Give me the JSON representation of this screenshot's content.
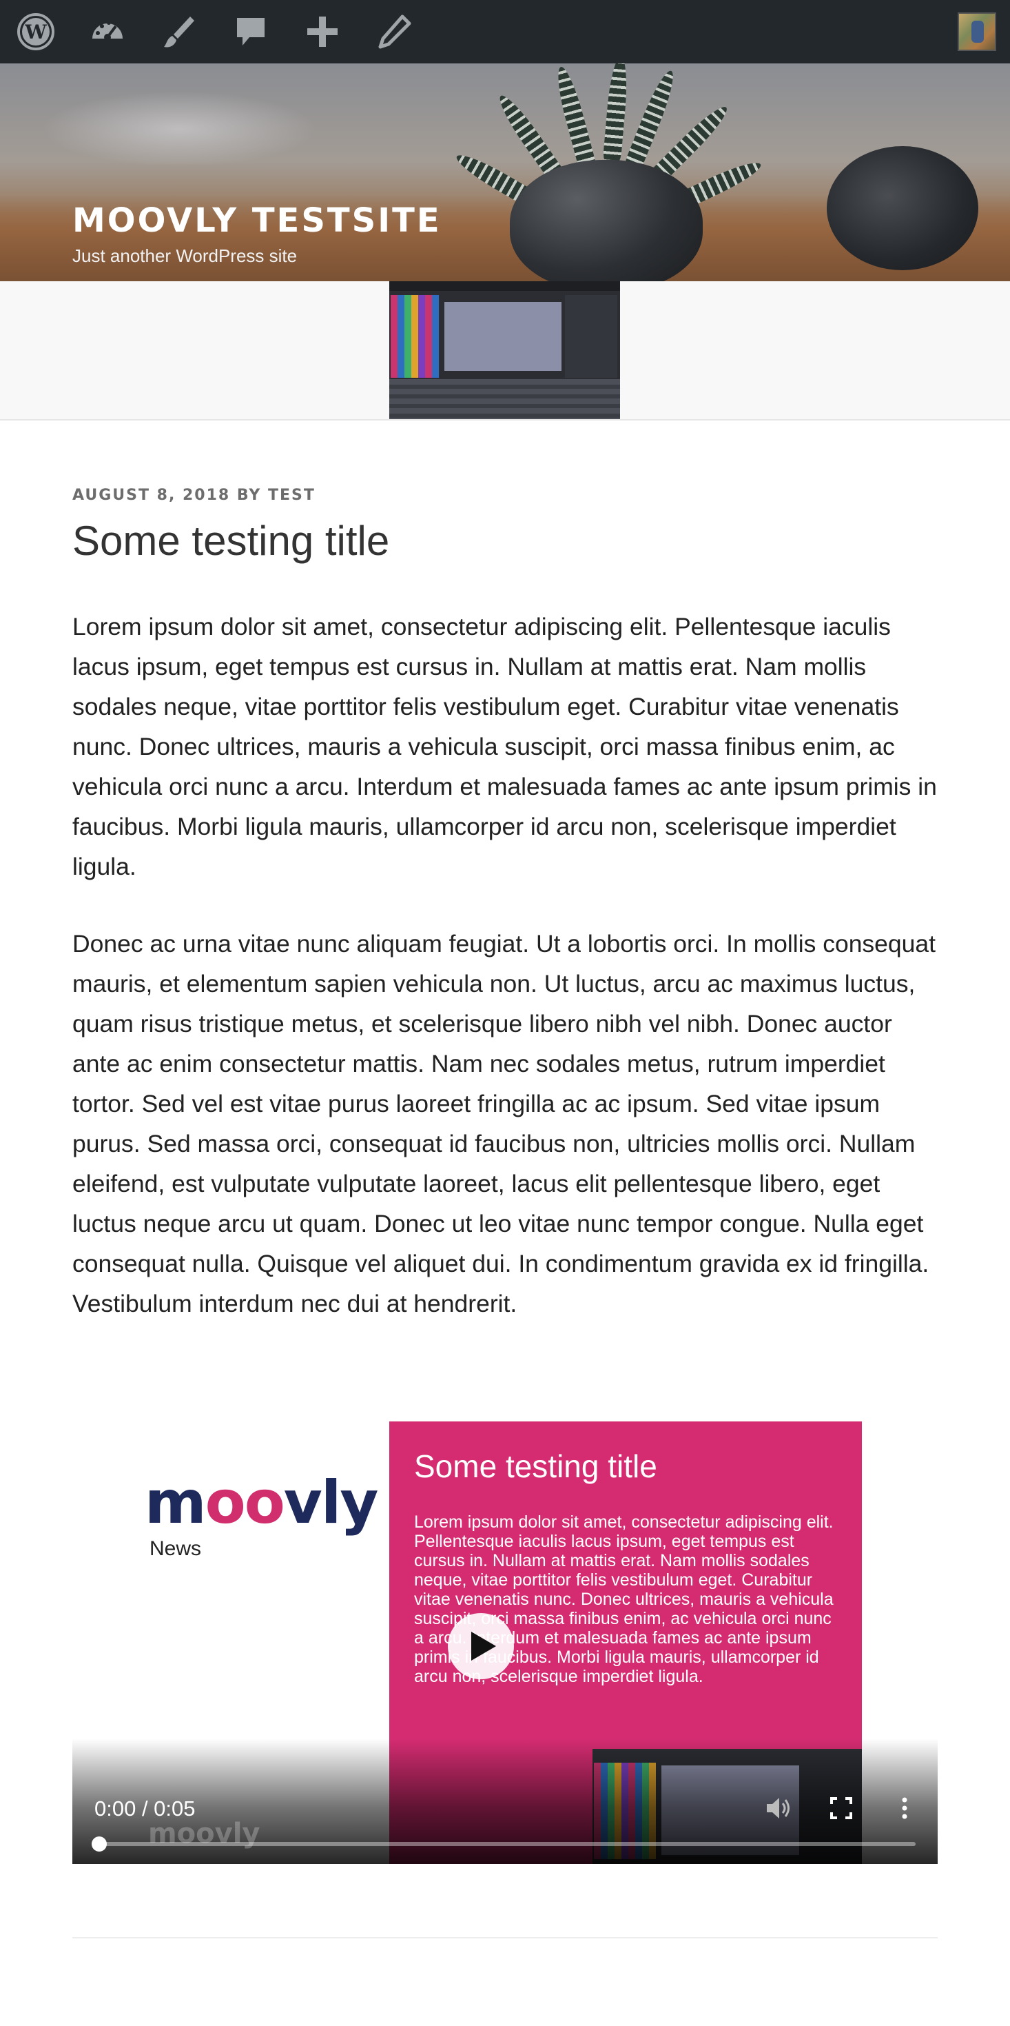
{
  "admin_bar": {
    "items": [
      {
        "icon": "wordpress-icon"
      },
      {
        "icon": "dashboard-icon"
      },
      {
        "icon": "customize-brush-icon"
      },
      {
        "icon": "comments-icon"
      },
      {
        "icon": "add-new-icon"
      },
      {
        "icon": "edit-pencil-icon"
      }
    ],
    "avatar": "user-avatar"
  },
  "header": {
    "site_title": "MOOVLY TESTSITE",
    "site_description": "Just another WordPress site"
  },
  "post": {
    "meta": "AUGUST 8, 2018 BY TEST",
    "title": "Some testing title",
    "paragraphs": [
      "Lorem ipsum dolor sit amet, consectetur adipiscing elit. Pellentesque iaculis lacus ipsum, eget tempus est cursus in. Nullam at mattis erat. Nam mollis sodales neque, vitae porttitor felis vestibulum eget. Curabitur vitae venenatis nunc. Donec ultrices, mauris a vehicula suscipit, orci massa finibus enim, ac vehicula orci nunc a arcu. Interdum et malesuada fames ac ante ipsum primis in faucibus. Morbi ligula mauris, ullamcorper id arcu non, scelerisque imperdiet ligula.",
      "Donec ac urna vitae nunc aliquam feugiat. Ut a lobortis orci. In mollis consequat mauris, et elementum sapien vehicula non. Ut luctus, arcu ac maximus luctus, quam risus tristique metus, et scelerisque libero nibh vel nibh. Donec auctor ante ac enim consectetur mattis. Nam nec sodales metus, rutrum imperdiet tortor. Sed vel est vitae purus laoreet fringilla ac ac ipsum. Sed vitae ipsum purus. Sed massa orci, consequat id faucibus non, ultricies mollis orci. Nullam eleifend, est vulputate vulputate laoreet, lacus elit pellentesque libero, eget luctus neque arcu ut quam. Donec ut leo vitae nunc tempor congue. Nulla eget consequat nulla. Quisque vel aliquet dui. In condimentum gravida ex id fringilla. Vestibulum interdum nec dui at hendrerit."
    ]
  },
  "video": {
    "logo_prefix": "m",
    "logo_middle": "oo",
    "logo_suffix": "vly",
    "logo_sub": "News",
    "slide_title": "Some testing title",
    "slide_text": "Lorem ipsum dolor sit amet, consectetur adipiscing elit. Pellentesque iaculis lacus ipsum, eget tempus est cursus in. Nullam at mattis erat. Nam mollis sodales neque, vitae porttitor felis vestibulum eget. Curabitur vitae venenatis nunc. Donec ultrices, mauris a vehicula suscipit, orci massa finibus enim, ac vehicula orci nunc a arcu. Interdum et malesuada fames ac ante ipsum primis in faucibus. Morbi ligula mauris, ullamcorper id arcu non, scelerisque imperdiet ligula.",
    "watermark": "moovly",
    "time": "0:00 / 0:05",
    "progress": 0.0,
    "controls": [
      "play-icon",
      "volume-icon",
      "fullscreen-icon",
      "more-options-icon"
    ],
    "accent_color": "#d52c71"
  },
  "colors": {
    "admin_bar": "#23282d",
    "brand_navy": "#1f2a5c",
    "brand_pink": "#d12e6d"
  }
}
